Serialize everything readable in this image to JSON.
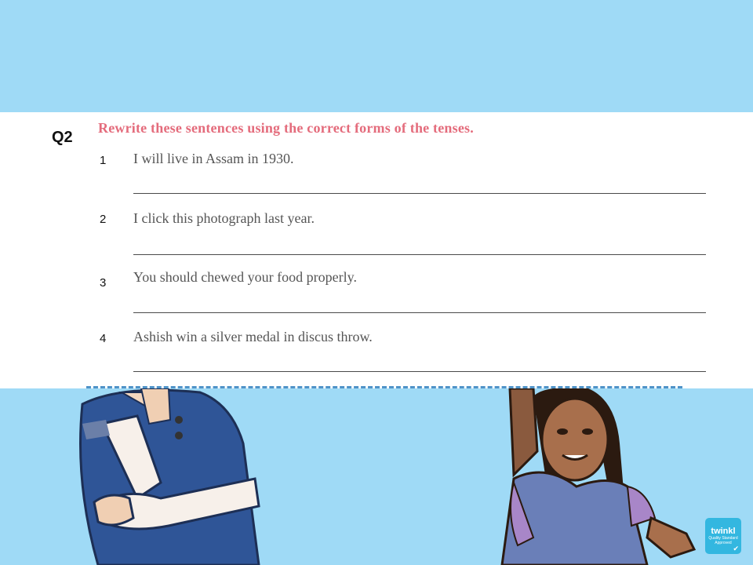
{
  "question": {
    "number": "Q2",
    "instruction": "Rewrite these sentences using the correct forms of the tenses."
  },
  "items": [
    {
      "number": "1",
      "text": "I will live in Assam in 1930."
    },
    {
      "number": "2",
      "text": "I click this photograph last year."
    },
    {
      "number": "3",
      "text": "You should chewed your food properly."
    },
    {
      "number": "4",
      "text": "Ashish win a silver medal in discus throw."
    }
  ],
  "logo": {
    "brand": "twinkl",
    "tag": "Quality Standard Approved"
  },
  "colors": {
    "background": "#9fdaf6",
    "instruction": "#e46c7c",
    "logo": "#33b7e0"
  }
}
